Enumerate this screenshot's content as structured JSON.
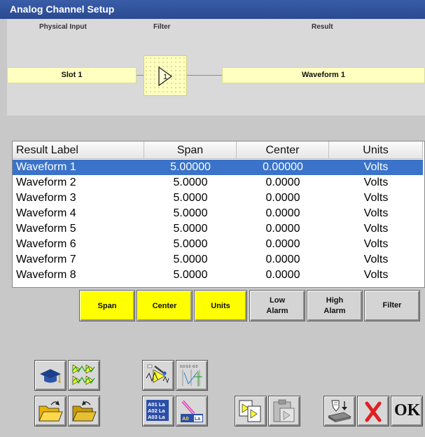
{
  "window": {
    "title": "Analog Channel Setup"
  },
  "pipeline": {
    "physical_input_header": "Physical Input",
    "filter_header": "Filter",
    "result_header": "Result",
    "slot_label": "Slot 1",
    "filter_symbol": "1",
    "result_label": "Waveform 1"
  },
  "table": {
    "columns": [
      "Result Label",
      "Span",
      "Center",
      "Units"
    ],
    "rows": [
      {
        "label": "Waveform 1",
        "span": "5.00000",
        "center": "0.00000",
        "units": "Volts",
        "selected": true
      },
      {
        "label": "Waveform 2",
        "span": "5.0000",
        "center": "0.0000",
        "units": "Volts"
      },
      {
        "label": "Waveform 3",
        "span": "5.0000",
        "center": "0.0000",
        "units": "Volts"
      },
      {
        "label": "Waveform 4",
        "span": "5.0000",
        "center": "0.0000",
        "units": "Volts"
      },
      {
        "label": "Waveform 5",
        "span": "5.0000",
        "center": "0.0000",
        "units": "Volts"
      },
      {
        "label": "Waveform 6",
        "span": "5.0000",
        "center": "0.0000",
        "units": "Volts"
      },
      {
        "label": "Waveform 7",
        "span": "5.0000",
        "center": "0.0000",
        "units": "Volts"
      },
      {
        "label": "Waveform 8",
        "span": "5.0000",
        "center": "0.0000",
        "units": "Volts"
      }
    ]
  },
  "column_buttons": {
    "span": "Span",
    "center": "Center",
    "units": "Units",
    "low_alarm_1": "Low",
    "low_alarm_2": "Alarm",
    "high_alarm_1": "High",
    "high_alarm_2": "Alarm",
    "filter": "Filter"
  },
  "toolbar": {
    "ok_label": "OK",
    "label_icon_lines": [
      "A01 La",
      "A02 La",
      "A03 La"
    ],
    "label_edit_text": "A0",
    "label_edit_suffix": "La",
    "axis_ticks": "0.0  0.0  -0.0"
  },
  "colors": {
    "title_bar": "#2a4a91",
    "selection": "#3a73c9",
    "yellow_button": "#ffff00",
    "pipeline_box": "#ffffc0",
    "cancel_red": "#e02020"
  }
}
